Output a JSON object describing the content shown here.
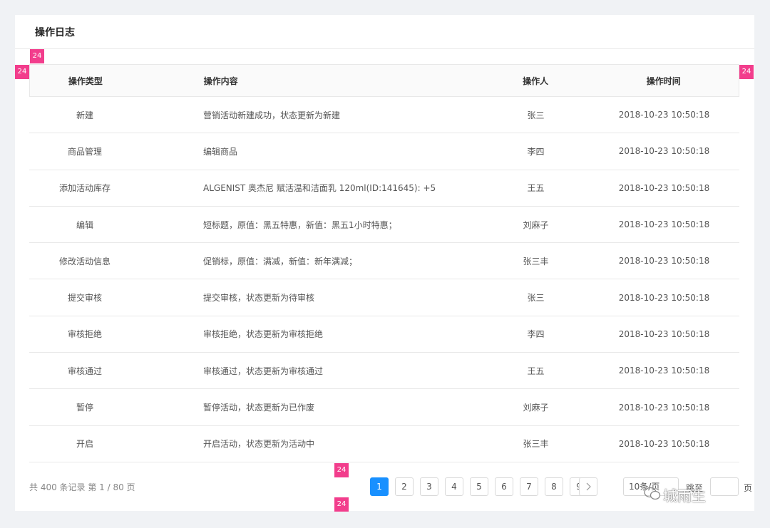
{
  "title": "操作日志",
  "markers": {
    "label": "24"
  },
  "table": {
    "columns": [
      "操作类型",
      "操作内容",
      "操作人",
      "操作时间"
    ],
    "rows": [
      [
        "新建",
        "营销活动新建成功，状态更新为新建",
        "张三",
        "2018-10-23 10:50:18"
      ],
      [
        "商品管理",
        "编辑商品",
        "李四",
        "2018-10-23 10:50:18"
      ],
      [
        "添加活动库存",
        "ALGENIST 奥杰尼 赋活温和洁面乳 120ml(ID:141645): +5",
        "王五",
        "2018-10-23 10:50:18"
      ],
      [
        "编辑",
        "短标题，原值：黑五特惠，新值：黑五1小时特惠；",
        "刘麻子",
        "2018-10-23 10:50:18"
      ],
      [
        "修改活动信息",
        "促销标，原值：满减，新值：新年满减；",
        "张三丰",
        "2018-10-23 10:50:18"
      ],
      [
        "提交审核",
        "提交审核，状态更新为待审核",
        "张三",
        "2018-10-23 10:50:18"
      ],
      [
        "审核拒绝",
        "审核拒绝，状态更新为审核拒绝",
        "李四",
        "2018-10-23 10:50:18"
      ],
      [
        "审核通过",
        "审核通过，状态更新为审核通过",
        "王五",
        "2018-10-23 10:50:18"
      ],
      [
        "暂停",
        "暂停活动，状态更新为已作废",
        "刘麻子",
        "2018-10-23 10:50:18"
      ],
      [
        "开启",
        "开启活动，状态更新为活动中",
        "张三丰",
        "2018-10-23 10:50:18"
      ]
    ]
  },
  "pagination": {
    "total_text": "共 400 条记录 第 1 / 80 页",
    "pages": [
      "1",
      "2",
      "3",
      "4",
      "5",
      "6",
      "7",
      "8",
      "9"
    ],
    "current": "1",
    "page_size": "10条/页",
    "jump_label": "跳至",
    "page_suffix": "页"
  },
  "watermark": "城雨生",
  "colors": {
    "accent": "#1890ff",
    "marker": "#f23d8c"
  }
}
